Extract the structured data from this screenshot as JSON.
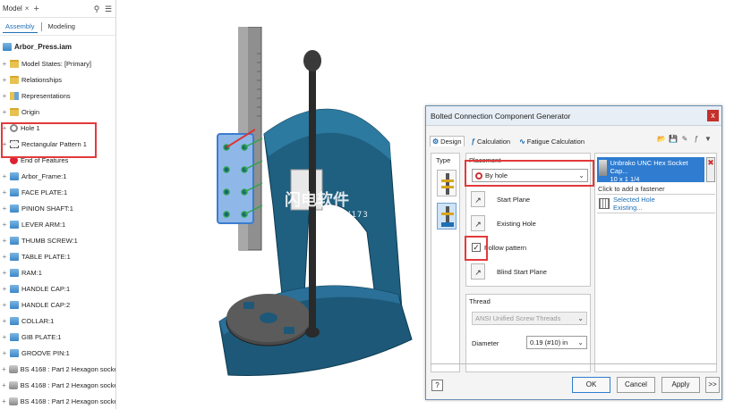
{
  "browser": {
    "tab_label": "Model",
    "tab_close": "×",
    "add_tab": "+",
    "tabs": [
      "Assembly",
      "Modeling"
    ],
    "root": "Arbor_Press.iam",
    "items": [
      {
        "label": "Model States: [Primary]",
        "icon": "folder-icon"
      },
      {
        "label": "Relationships",
        "icon": "folder-icon"
      },
      {
        "label": "Representations",
        "icon": "representations-icon"
      },
      {
        "label": "Origin",
        "icon": "folder-icon"
      },
      {
        "label": "Hole 1",
        "icon": "hole-icon"
      },
      {
        "label": "Rectangular Pattern 1",
        "icon": "pattern-icon"
      },
      {
        "label": "End of Features",
        "icon": "end-of-features-icon"
      },
      {
        "label": "Arbor_Frame:1",
        "icon": "part-icon"
      },
      {
        "label": "FACE PLATE:1",
        "icon": "part-icon"
      },
      {
        "label": "PINION SHAFT:1",
        "icon": "part-icon"
      },
      {
        "label": "LEVER ARM:1",
        "icon": "part-icon"
      },
      {
        "label": "THUMB SCREW:1",
        "icon": "part-icon"
      },
      {
        "label": "TABLE PLATE:1",
        "icon": "part-icon"
      },
      {
        "label": "RAM:1",
        "icon": "part-icon"
      },
      {
        "label": "HANDLE CAP:1",
        "icon": "part-icon"
      },
      {
        "label": "HANDLE CAP:2",
        "icon": "part-icon"
      },
      {
        "label": "COLLAR:1",
        "icon": "part-icon"
      },
      {
        "label": "GIB PLATE:1",
        "icon": "part-icon"
      },
      {
        "label": "GROOVE PIN:1",
        "icon": "part-icon"
      },
      {
        "label": "BS 4168 : Part 2 Hexagon socket s",
        "icon": "bolt-icon"
      },
      {
        "label": "BS 4168 : Part 2 Hexagon socket s",
        "icon": "bolt-icon"
      },
      {
        "label": "BS 4168 : Part 2 Hexagon socket s",
        "icon": "bolt-icon"
      }
    ]
  },
  "watermark": {
    "text": "闪电软件",
    "url": "www.sd173"
  },
  "dialog": {
    "title": "Bolted Connection Component Generator",
    "close": "x",
    "tabs": [
      "Design",
      "Calculation",
      "Fatigue Calculation"
    ],
    "type_label": "Type",
    "placement_label": "Placement",
    "placement_value": "By hole",
    "start_plane": "Start Plane",
    "existing_hole": "Existing Hole",
    "follow_pattern": "Follow pattern",
    "follow_pattern_checked": true,
    "blind_start_plane": "Blind Start Plane",
    "thread_label": "Thread",
    "thread_value": "ANSI Unified Screw Threads",
    "diameter_label": "Diameter",
    "diameter_value": "0.19 (#10) in",
    "fastener_name": "Unbrako UNC Hex Socket Cap...",
    "fastener_size": "10 x 1 1/4",
    "click_to_add": "Click to add a fastener",
    "selected_hole": "Selected Hole",
    "existing": "Existing...",
    "buttons": {
      "ok": "OK",
      "cancel": "Cancel",
      "apply": "Apply",
      "more": ">>",
      "help": "?"
    }
  },
  "colors": {
    "accent": "#2f7cd0",
    "highlight": "#e23a3a",
    "model_body": "#1f5f80"
  }
}
